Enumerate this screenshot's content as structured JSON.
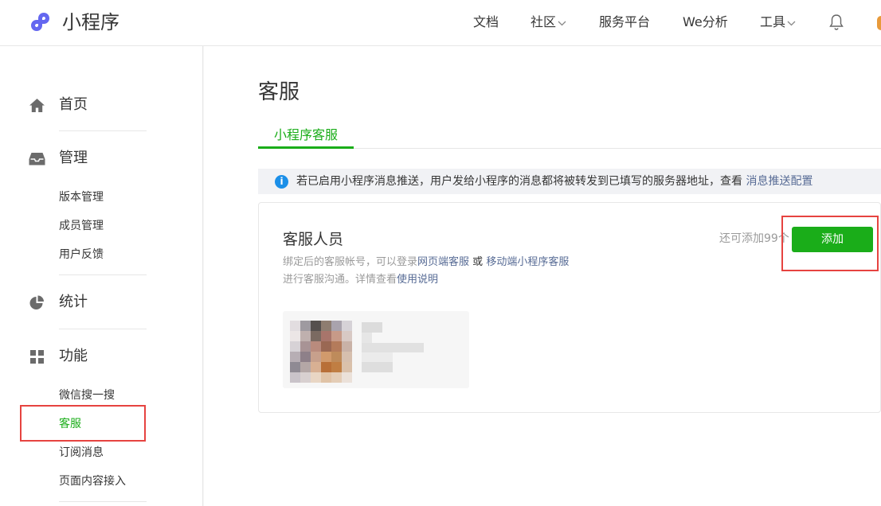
{
  "header": {
    "brand": "小程序",
    "nav": {
      "docs": "文档",
      "community": "社区",
      "service_platform": "服务平台",
      "we_analysis": "We分析",
      "tools": "工具"
    },
    "icons": [
      "logo-icon",
      "chevron-down-icon",
      "bell-icon"
    ]
  },
  "sidebar": {
    "home": "首页",
    "manage": {
      "label": "管理",
      "items": [
        "版本管理",
        "成员管理",
        "用户反馈"
      ]
    },
    "stats": "统计",
    "features": {
      "label": "功能",
      "items": [
        "微信搜一搜",
        "客服",
        "订阅消息",
        "页面内容接入"
      ]
    }
  },
  "main": {
    "title": "客服",
    "tab": "小程序客服",
    "notice": {
      "text": "若已启用小程序消息推送，用户发给小程序的消息都将被转发到已填写的服务器地址，查看",
      "link": "消息推送配置"
    },
    "card": {
      "title": "客服人员",
      "desc_prefix": "绑定后的客服帐号，可以登录",
      "desc_link1": "网页端客服",
      "desc_or": "或",
      "desc_link2": "移动端小程序客服",
      "desc2_prefix": "进行客服沟通。详情查看",
      "desc2_link": "使用说明",
      "quota": "还可添加99个",
      "add_button": "添加"
    }
  },
  "colors": {
    "accent": "#1aad19",
    "link": "#576b95",
    "highlight": "#e64340",
    "info": "#1b8fe8"
  }
}
